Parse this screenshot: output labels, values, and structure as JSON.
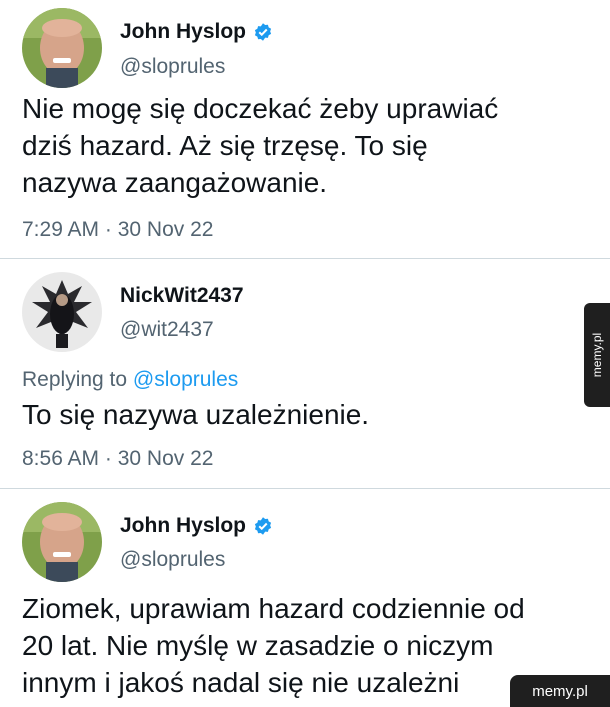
{
  "tweets": [
    {
      "name": "John Hyslop",
      "verified": true,
      "handle": "@sloprules",
      "text_lines": [
        "Nie mogę się doczekać żeby uprawiać",
        "dziś hazard. Aż się trzęsę. To się",
        "nazywa zaangażowanie."
      ],
      "timestamp": "7:29 AM · 30 Nov 22"
    },
    {
      "name": "NickWit2437",
      "verified": false,
      "handle": "@wit2437",
      "replying_prefix": "Replying to",
      "replying_handle": "@sloprules",
      "text_lines": [
        "To się nazywa uzależnienie."
      ],
      "timestamp": "8:56 AM · 30 Nov 22"
    },
    {
      "name": "John Hyslop",
      "verified": true,
      "handle": "@sloprules",
      "text_lines": [
        "Ziomek, uprawiam hazard codziennie od",
        "20 lat. Nie myślę w zasadzie o niczym",
        "innym i jakoś nadal się nie uzależni"
      ]
    }
  ],
  "watermarks": {
    "side": "memy.pl",
    "corner": "memy.pl"
  },
  "colors": {
    "verified_badge": "#1d9bf0",
    "link": "#1d9bf0",
    "secondary_text": "#536471"
  }
}
